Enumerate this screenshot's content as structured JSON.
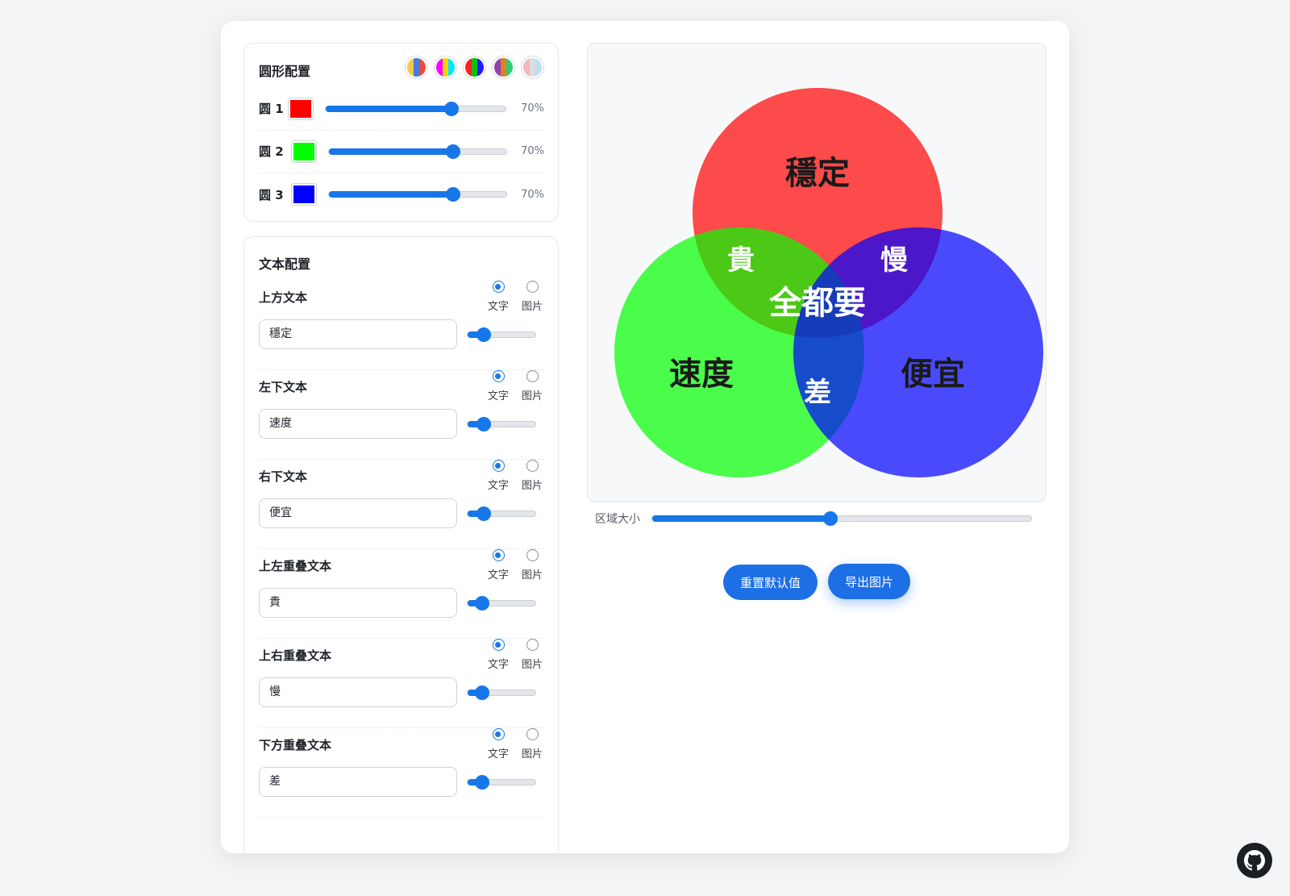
{
  "circle_config": {
    "title": "圆形配置",
    "presets": [
      {
        "name": "preset-warm",
        "colors": [
          "#f2c94c",
          "#4a7bd8",
          "#e74c3c"
        ]
      },
      {
        "name": "preset-cmy",
        "colors": [
          "#ff00ff",
          "#ffd400",
          "#00e5ff"
        ]
      },
      {
        "name": "preset-rgb",
        "colors": [
          "#ff2020",
          "#10c010",
          "#2020ff"
        ]
      },
      {
        "name": "preset-mixed",
        "colors": [
          "#8e44ad",
          "#e67e22",
          "#2ecc71"
        ]
      },
      {
        "name": "preset-pastel",
        "colors": [
          "#f4b6b6",
          "#d9dde2",
          "#b9e0f0"
        ]
      }
    ],
    "circles": [
      {
        "label": "圆 1",
        "color": "#ff0000",
        "opacity": 0.7,
        "value": "70%"
      },
      {
        "label": "圆 2",
        "color": "#00ff00",
        "opacity": 0.7,
        "value": "70%"
      },
      {
        "label": "圆 3",
        "color": "#0000ff",
        "opacity": 0.7,
        "value": "70%"
      }
    ]
  },
  "text_config": {
    "title": "文本配置",
    "option_text": "文字",
    "option_image": "图片",
    "rows": [
      {
        "label": "上方文本",
        "value": "穩定",
        "size": 0.24
      },
      {
        "label": "左下文本",
        "value": "速度",
        "size": 0.24
      },
      {
        "label": "右下文本",
        "value": "便宜",
        "size": 0.24
      },
      {
        "label": "上左重叠文本",
        "value": "貴",
        "size": 0.21
      },
      {
        "label": "上右重叠文本",
        "value": "慢",
        "size": 0.21
      },
      {
        "label": "下方重叠文本",
        "value": "差",
        "size": 0.21
      }
    ]
  },
  "preview": {
    "top": "穩定",
    "left": "速度",
    "right": "便宜",
    "top_left": "貴",
    "top_right": "慢",
    "bottom": "差",
    "center": "全都要"
  },
  "area_size": {
    "label": "区域大小",
    "value": 0.47
  },
  "buttons": {
    "reset": "重置默认值",
    "export": "导出图片"
  }
}
